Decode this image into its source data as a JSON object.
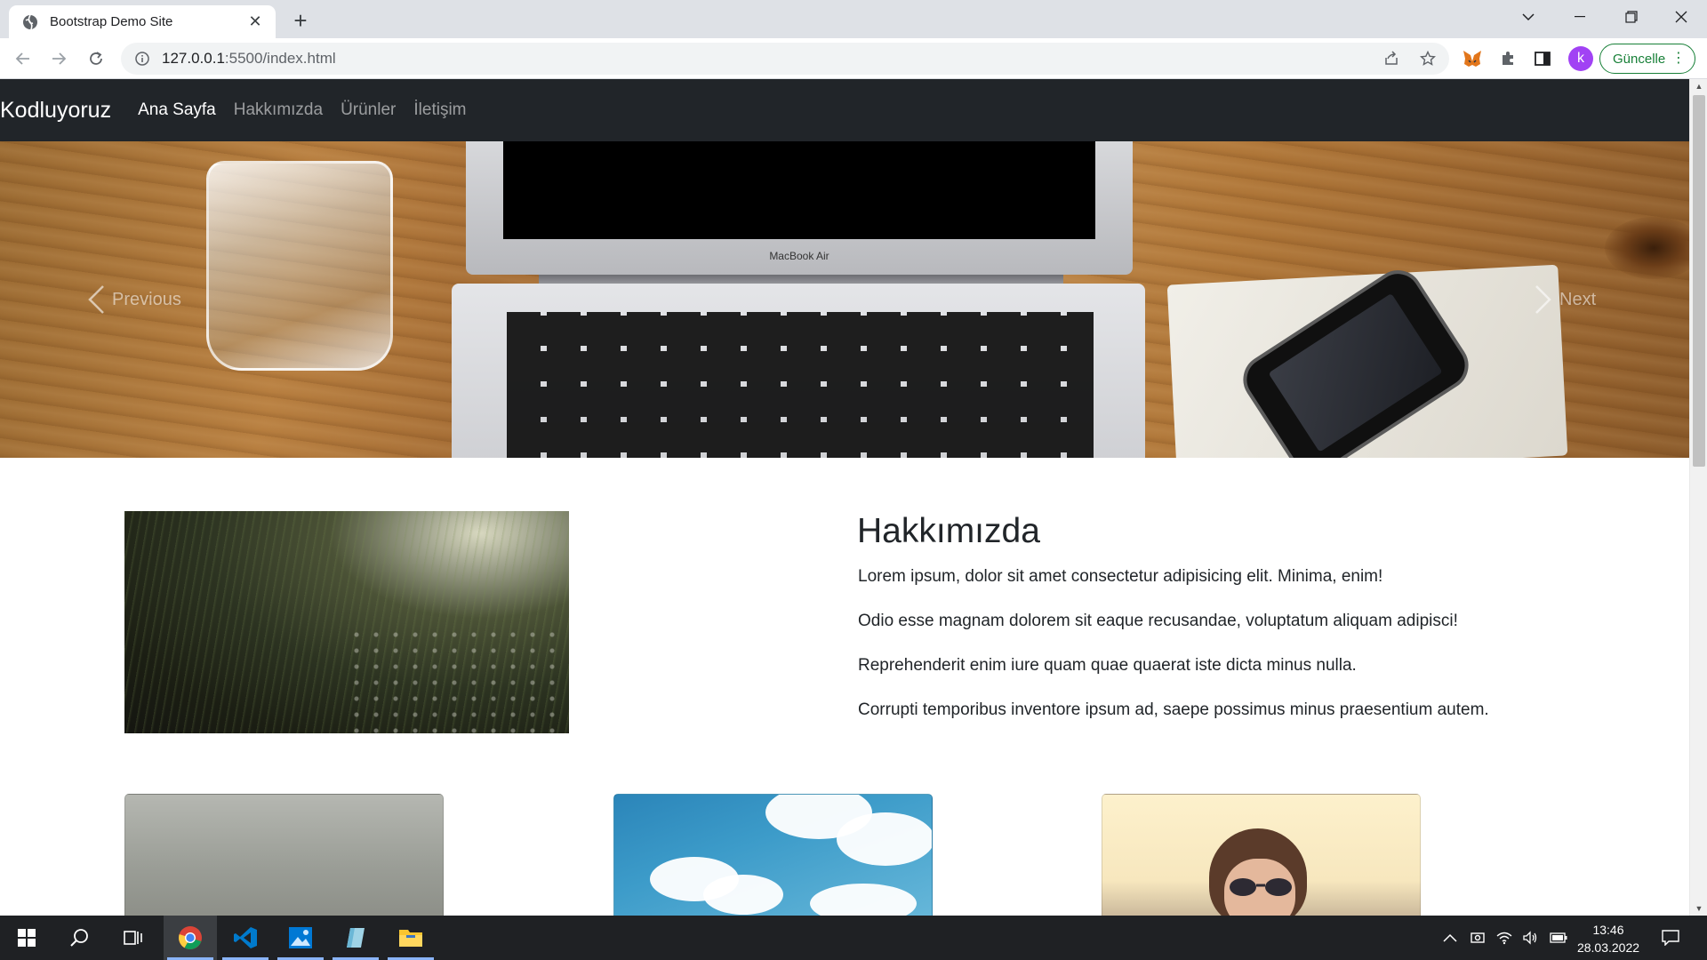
{
  "browser": {
    "tab_title": "Bootstrap Demo Site",
    "url_host": "127.0.0.1",
    "url_path": ":5500/index.html",
    "update_label": "Güncelle",
    "profile_initial": "k"
  },
  "site": {
    "brand": "Kodluyoruz",
    "nav": [
      {
        "label": "Ana Sayfa",
        "active": true
      },
      {
        "label": "Hakkımızda",
        "active": false
      },
      {
        "label": "Ürünler",
        "active": false
      },
      {
        "label": "İletişim",
        "active": false
      }
    ],
    "carousel": {
      "prev_label": "Previous",
      "next_label": "Next",
      "laptop_text": "MacBook Air"
    },
    "about": {
      "title": "Hakkımızda",
      "paragraphs": [
        "Lorem ipsum, dolor sit amet consectetur adipisicing elit. Minima, enim!",
        "Odio esse magnam dolorem sit eaque recusandae, voluptatum aliquam adipisci!",
        "Reprehenderit enim iure quam quae quaerat iste dicta minus nulla.",
        "Corrupti temporibus inventore ipsum ad, saepe possimus minus praesentium autem."
      ]
    }
  },
  "taskbar": {
    "time": "13:46",
    "date": "28.03.2022"
  },
  "colors": {
    "navbar_bg": "#212529",
    "update_green": "#188038",
    "avatar_purple": "#a142f4"
  }
}
